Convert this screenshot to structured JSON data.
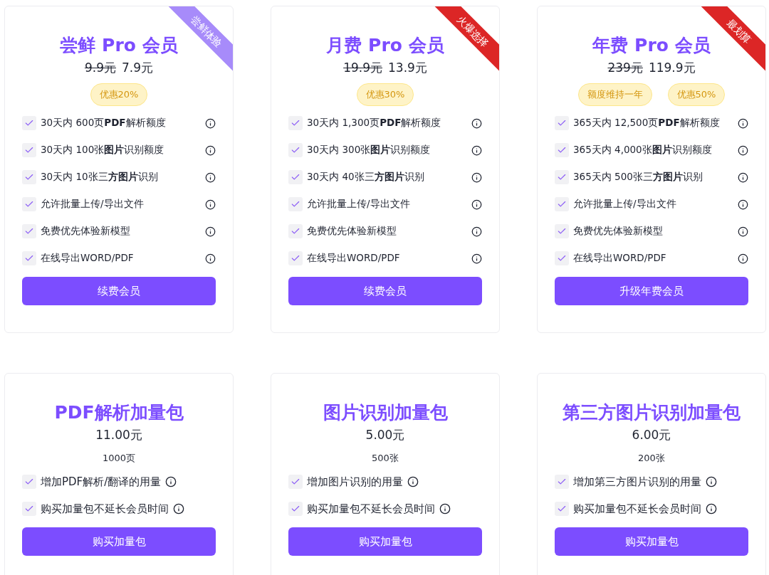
{
  "plans": [
    {
      "title": "尝鲜 Pro 会员",
      "ribbon": {
        "text": "尝鲜体验",
        "color": "#a78bfa"
      },
      "old_price": "9.9元",
      "price": "7.9元",
      "badges": [
        "优惠20%"
      ],
      "features": [
        "30天内 600页**PDF**解析额度",
        "30天内 100张**图片**识别额度",
        "30天内 10张三**方图片**识别",
        "允许批量上传/导出文件",
        "免费优先体验新模型",
        "在线导出WORD/PDF"
      ],
      "button": "续费会员"
    },
    {
      "title": "月费 Pro 会员",
      "ribbon": {
        "text": "火爆选择",
        "color": "#dc2626"
      },
      "old_price": "19.9元",
      "price": "13.9元",
      "badges": [
        "优惠30%"
      ],
      "features": [
        "30天内 1,300页**PDF**解析额度",
        "30天内 300张**图片**识别额度",
        "30天内 40张三**方图片**识别",
        "允许批量上传/导出文件",
        "免费优先体验新模型",
        "在线导出WORD/PDF"
      ],
      "button": "续费会员"
    },
    {
      "title": "年费 Pro 会员",
      "ribbon": {
        "text": "最划算",
        "color": "#dc2626"
      },
      "old_price": "239元",
      "price": "119.9元",
      "badges": [
        "额度维持一年",
        "优惠50%"
      ],
      "features": [
        "365天内 12,500页**PDF**解析额度",
        "365天内 4,000张**图片**识别额度",
        "365天内 500张三**方图片**识别",
        "允许批量上传/导出文件",
        "免费优先体验新模型",
        "在线导出WORD/PDF"
      ],
      "button": "升级年费会员"
    }
  ],
  "packs": [
    {
      "title": "PDF解析加量包",
      "price": "11.00元",
      "amount": "1000页",
      "features": [
        "增加PDF解析/翻译的用量",
        "购买加量包不延长会员时间"
      ],
      "button": "购买加量包"
    },
    {
      "title": "图片识别加量包",
      "price": "5.00元",
      "amount": "500张",
      "features": [
        "增加图片识别的用量",
        "购买加量包不延长会员时间"
      ],
      "button": "购买加量包"
    },
    {
      "title": "第三方图片识别加量包",
      "price": "6.00元",
      "amount": "200张",
      "features": [
        "增加第三方图片识别的用量",
        "购买加量包不延长会员时间"
      ],
      "button": "购买加量包"
    }
  ]
}
